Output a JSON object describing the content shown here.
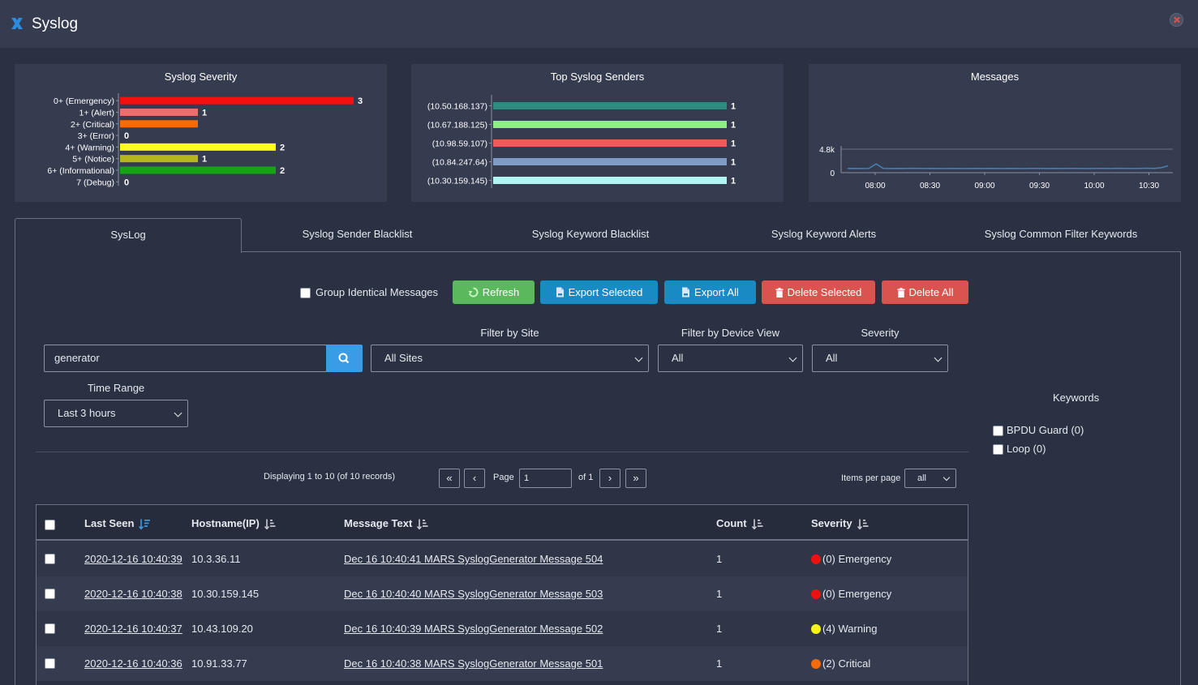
{
  "window": {
    "title": "Syslog"
  },
  "severity_chart": {
    "title": "Syslog Severity",
    "chart_data": {
      "type": "bar",
      "categories": [
        "0+ (Emergency)",
        "1+ (Alert)",
        "2+ (Critical)",
        "3+ (Error)",
        "4+ (Warning)",
        "5+ (Notice)",
        "6+ (Informational)",
        "7 (Debug)"
      ],
      "values": [
        3,
        1,
        1,
        0,
        2,
        1,
        2,
        0
      ],
      "labels": [
        "3",
        "1",
        "",
        "0",
        "2",
        "1",
        "2",
        "0"
      ],
      "colors": [
        "#f50f0f",
        "#f06d6d",
        "#f56b0a",
        "#e6e6e6",
        "#ffff1a",
        "#b5b51e",
        "#16a316",
        "#e6e6e6"
      ],
      "xlim": [
        0,
        3
      ]
    }
  },
  "senders_chart": {
    "title": "Top Syslog Senders",
    "chart_data": {
      "type": "bar",
      "categories": [
        "(10.50.168.137)",
        "(10.67.188.125)",
        "(10.98.59.107)",
        "(10.84.247.64)",
        "(10.30.159.145)"
      ],
      "values": [
        1,
        1,
        1,
        1,
        1
      ],
      "colors": [
        "#2e8b7f",
        "#90ee7e",
        "#f05a5a",
        "#7f9cc4",
        "#aff5f5"
      ],
      "xlim": [
        0,
        1
      ]
    }
  },
  "messages_chart": {
    "title": "Messages",
    "chart_data": {
      "type": "line",
      "x_ticks": [
        "08:00",
        "08:30",
        "09:00",
        "09:30",
        "10:00",
        "10:30"
      ],
      "y_ticks": [
        "4.8k",
        "0"
      ],
      "ylim": [
        0,
        4800
      ],
      "color": "#4a7fb0",
      "series": [
        {
          "values": [
            340,
            360,
            340,
            360,
            1300,
            380,
            350,
            360,
            340,
            400,
            360,
            340,
            360,
            350,
            340,
            360,
            340,
            350,
            380,
            340,
            360,
            350,
            340,
            360,
            350,
            340,
            380,
            360,
            340,
            360,
            340,
            380,
            360,
            350,
            340,
            370,
            360,
            340,
            400,
            360,
            340,
            380,
            420,
            360,
            500,
            900
          ]
        }
      ]
    }
  },
  "tabs": [
    {
      "label": "SysLog",
      "active": true
    },
    {
      "label": "Syslog Sender Blacklist"
    },
    {
      "label": "Syslog Keyword Blacklist"
    },
    {
      "label": "Syslog Keyword Alerts"
    },
    {
      "label": "Syslog Common Filter Keywords"
    }
  ],
  "toolbar": {
    "group_label": "Group Identical Messages",
    "refresh": "Refresh",
    "export_selected": "Export Selected",
    "export_all": "Export All",
    "delete_selected": "Delete Selected",
    "delete_all": "Delete All"
  },
  "filters": {
    "search_value": "generator",
    "site_label": "Filter by Site",
    "site_value": "All Sites",
    "device_label": "Filter by Device View",
    "device_value": "All",
    "severity_label": "Severity",
    "severity_value": "All",
    "time_label": "Time Range",
    "time_value": "Last 3 hours"
  },
  "keywords": {
    "title": "Keywords",
    "items": [
      "BPDU Guard (0)",
      "Loop (0)"
    ]
  },
  "pager": {
    "info": "Displaying 1 to 10 (of 10 records)",
    "first": "«",
    "prev": "‹",
    "page_label": "Page",
    "page_value": "1",
    "of_label": "of 1",
    "next": "›",
    "last": "»",
    "ipp_label": "Items per page",
    "ipp_value": "all"
  },
  "table": {
    "headers": {
      "last_seen": "Last Seen",
      "hostname": "Hostname(IP)",
      "message": "Message Text",
      "count": "Count",
      "severity": "Severity"
    },
    "rows": [
      {
        "last_seen": "2020-12-16 10:40:39",
        "host": "10.3.36.11",
        "message": "Dec 16 10:40:41 MARS SyslogGenerator Message 504",
        "count": "1",
        "severity": "(0) Emergency",
        "sev_color": "#ee1111"
      },
      {
        "last_seen": "2020-12-16 10:40:38",
        "host": "10.30.159.145",
        "message": "Dec 16 10:40:40 MARS SyslogGenerator Message 503",
        "count": "1",
        "severity": "(0) Emergency",
        "sev_color": "#ee1111"
      },
      {
        "last_seen": "2020-12-16 10:40:37",
        "host": "10.43.109.20",
        "message": "Dec 16 10:40:39 MARS SyslogGenerator Message 502",
        "count": "1",
        "severity": "(4) Warning",
        "sev_color": "#f5f511"
      },
      {
        "last_seen": "2020-12-16 10:40:36",
        "host": "10.91.33.77",
        "message": "Dec 16 10:40:38 MARS SyslogGenerator Message 501",
        "count": "1",
        "severity": "(2) Critical",
        "sev_color": "#f56b0a"
      }
    ]
  }
}
